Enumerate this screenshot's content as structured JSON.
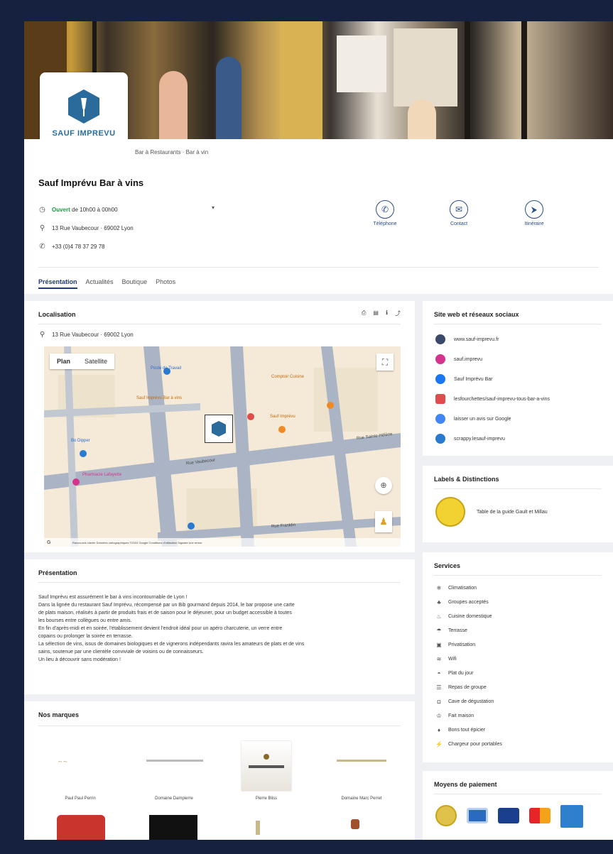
{
  "business": {
    "logo_text": "SAUF IMPREVU",
    "category": "Bar à Restaurants · Bar à vin",
    "name": "Sauf Imprévu Bar à vins",
    "hours_status": "Ouvert",
    "hours_text": "de 10h00 à 00h00",
    "address": "13 Rue Vaubecour · 69002 Lyon",
    "phone": "+33 (0)4 78 37 29 78"
  },
  "actions": [
    {
      "label": "Téléphone",
      "icon": "phone-icon"
    },
    {
      "label": "Contact",
      "icon": "mail-icon"
    },
    {
      "label": "Itinéraire",
      "icon": "directions-icon"
    }
  ],
  "tabs": [
    "Présentation",
    "Actualités",
    "Boutique",
    "Photos"
  ],
  "location": {
    "title": "Localisation",
    "address": "13 Rue Vaubecour · 69002 Lyon",
    "map_plan": "Plan",
    "map_satellite": "Satellite",
    "map_labels": {
      "place1": "Poste de Travail",
      "place2": "Sauf Imprévu Bar à vins",
      "place3": "Comptoir Cuisine",
      "place4": "Sauf Imprévu",
      "place5": "Bo Dipper",
      "place6": "Pharmacie Lafayette",
      "street1": "Rue Vaubecour",
      "street2": "Rue Sainte-Hélène",
      "street3": "Rue Franklin",
      "footer": "Raccourcis clavier   Données cartographiques ©2024 Google   Conditions d'utilisation   Signaler une erreur"
    }
  },
  "presentation": {
    "title": "Présentation",
    "lines": [
      "Sauf Imprévu est assurément le bar à vins incontournable de Lyon !",
      "Dans la lignée du restaurant Sauf Imprévu, récompensé par un Bib gourmand depuis 2014, le bar propose une carte",
      "de plats maison, réalisés à partir de produits frais et de saison pour le déjeuner, pour un budget accessible à toutes",
      "les bourses entre collègues ou entre amis.",
      "En fin d'après-midi et en soirée, l'établissement devient l'endroit idéal pour un apéro charcuterie, un verre entre",
      "copains ou prolonger la soirée en terrasse.",
      "La sélection de vins, issus de domaines biologiques et de vignerons indépendants ravira les amateurs de plats et de vins",
      "sains, soutenue par une clientèle conviviale de voisins ou de connaisseurs.",
      "Un lieu à découvrir sans modération !"
    ]
  },
  "brands": {
    "title": "Nos marques",
    "items": [
      "Paul Paul Perrin",
      "Domaine Dampierre",
      "Pierre Bliss",
      "Domaine Marc Perret"
    ]
  },
  "web": {
    "title": "Site web et réseaux sociaux",
    "links": [
      {
        "label": "www.sauf-imprevu.fr",
        "color": "#3a4a6a"
      },
      {
        "label": "sauf.imprevu",
        "color": "#d6348c"
      },
      {
        "label": "Sauf Imprévu Bar",
        "color": "#1877f2"
      },
      {
        "label": "lesfourchettes/sauf-imprevu-tous-bar-a-vins",
        "color": "#e24b4b"
      },
      {
        "label": "laisser un avis sur Google",
        "color": "#4285f4"
      },
      {
        "label": "scrappy.lesauf-imprevu",
        "color": "#2a7ad0"
      }
    ]
  },
  "labels": {
    "title": "Labels & Distinctions",
    "item": "Table de la guide Gault et Millau"
  },
  "services": {
    "title": "Services",
    "items": [
      {
        "label": "Climatisation",
        "icon": "snowflake-icon",
        "glyph": "❄"
      },
      {
        "label": "Groupes acceptés",
        "icon": "group-icon",
        "glyph": "♣"
      },
      {
        "label": "Cuisine domestique",
        "icon": "cooking-icon",
        "glyph": "♨"
      },
      {
        "label": "Terrasse",
        "icon": "terrace-icon",
        "glyph": "☂"
      },
      {
        "label": "Privatisation",
        "icon": "calendar-icon",
        "glyph": "▣"
      },
      {
        "label": "Wifi",
        "icon": "wifi-icon",
        "glyph": "≋"
      },
      {
        "label": "Plat du jour",
        "icon": "dish-icon",
        "glyph": "◓"
      },
      {
        "label": "Repas de groupe",
        "icon": "table-icon",
        "glyph": "☰"
      },
      {
        "label": "Cave de dégustation",
        "icon": "bottle-icon",
        "glyph": "◘"
      },
      {
        "label": "Fait maison",
        "icon": "chef-icon",
        "glyph": "♔"
      },
      {
        "label": "Bons tout épicier",
        "icon": "cart-icon",
        "glyph": "♦"
      },
      {
        "label": "Chargeur pour portables",
        "icon": "charger-icon",
        "glyph": "⚡"
      }
    ]
  },
  "payments": {
    "title": "Moyens de paiement",
    "methods": [
      {
        "name": "gold-coin",
        "color": "#e0c24a"
      },
      {
        "name": "card",
        "color": "#2a6bbf"
      },
      {
        "name": "visa",
        "color": "#1a3f8f"
      },
      {
        "name": "mastercard",
        "color": "#e8542b"
      },
      {
        "name": "amex",
        "color": "#2f7fcf"
      }
    ]
  }
}
